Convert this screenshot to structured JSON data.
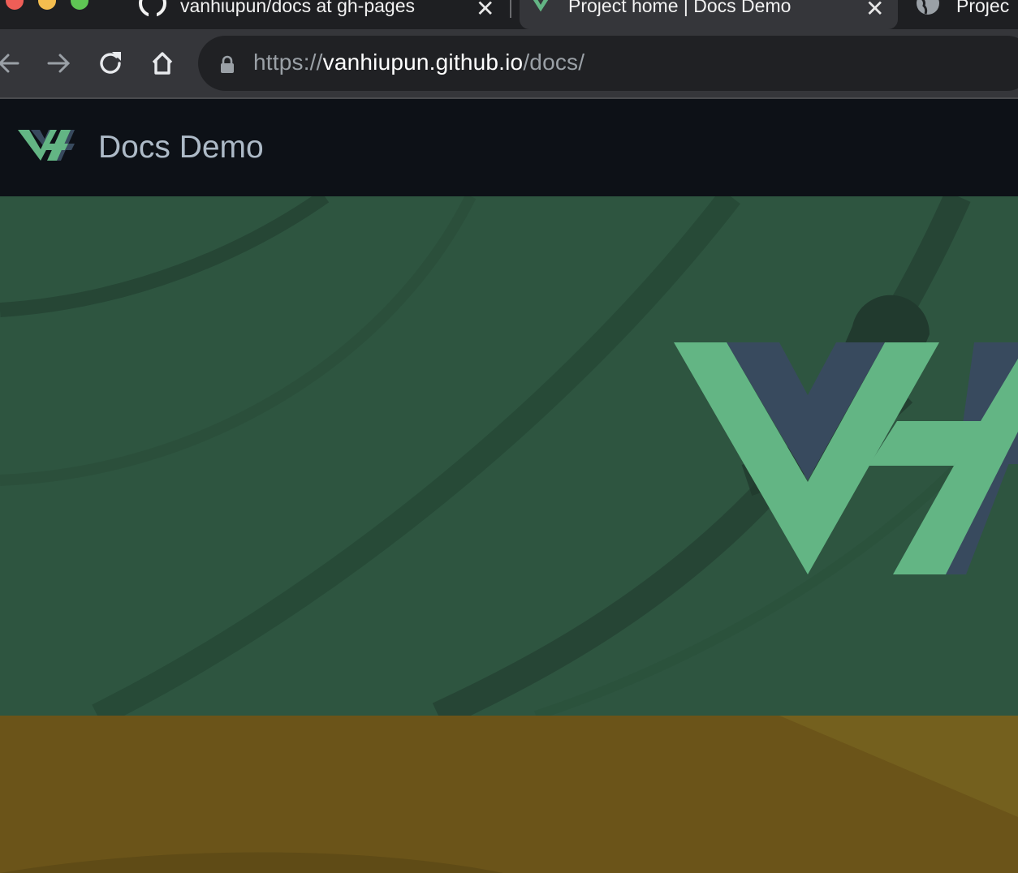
{
  "browser": {
    "tabs": [
      {
        "title": "vanhiupun/docs at gh-pages",
        "icon": "github-icon",
        "active": false
      },
      {
        "title": "Project home | Docs Demo",
        "icon": "vh-logo-icon",
        "active": true
      },
      {
        "title": "Projec",
        "icon": "globe-icon",
        "active": false
      }
    ],
    "url": {
      "scheme": "https://",
      "host": "vanhiupun.github.io",
      "path": "/docs/"
    }
  },
  "site": {
    "title": "Docs Demo",
    "logo": "vh-logo"
  },
  "colors": {
    "header_bg": "#0d1117",
    "hero_bg": "#2e5540",
    "logo_green": "#63b584",
    "logo_navy": "#384a5e",
    "bottom_band": "#6b5419"
  }
}
